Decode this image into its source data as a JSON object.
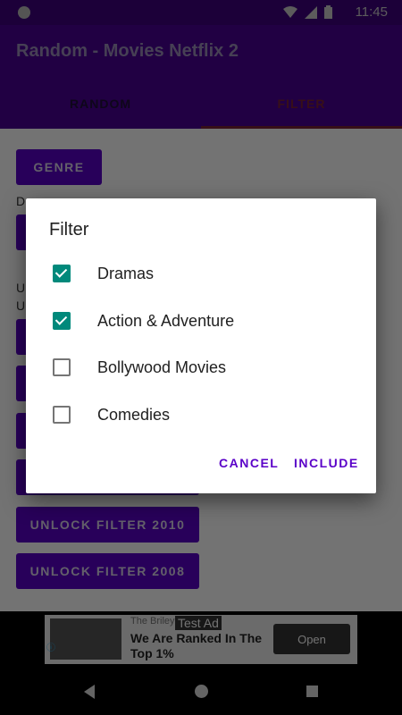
{
  "status_bar": {
    "time": "11:45"
  },
  "app_bar": {
    "title": "Random - Movies Netflix 2"
  },
  "tabs": [
    {
      "label": "RANDOM",
      "selected": false
    },
    {
      "label": "FILTER",
      "selected": true
    }
  ],
  "content": {
    "genre_button": "GENRE",
    "genre_value": "Dramas",
    "unlock_text_1": "U",
    "unlock_text_2": "U",
    "unlock_2010": "UNLOCK FILTER 2010",
    "unlock_2008": "UNLOCK FILTER 2008"
  },
  "dialog": {
    "title": "Filter",
    "options": [
      {
        "label": "Dramas",
        "checked": true
      },
      {
        "label": "Action & Adventure",
        "checked": true
      },
      {
        "label": "Bollywood Movies",
        "checked": false
      },
      {
        "label": "Comedies",
        "checked": false
      }
    ],
    "cancel_label": "CANCEL",
    "include_label": "INCLUDE"
  },
  "ad": {
    "brand": "The Briley",
    "tag": "Test Ad",
    "headline": "We Are Ranked In The Top 1%",
    "cta": "Open"
  },
  "colors": {
    "primary": "#4a0095",
    "accent": "#5a00c8",
    "checkbox": "#00897b"
  }
}
